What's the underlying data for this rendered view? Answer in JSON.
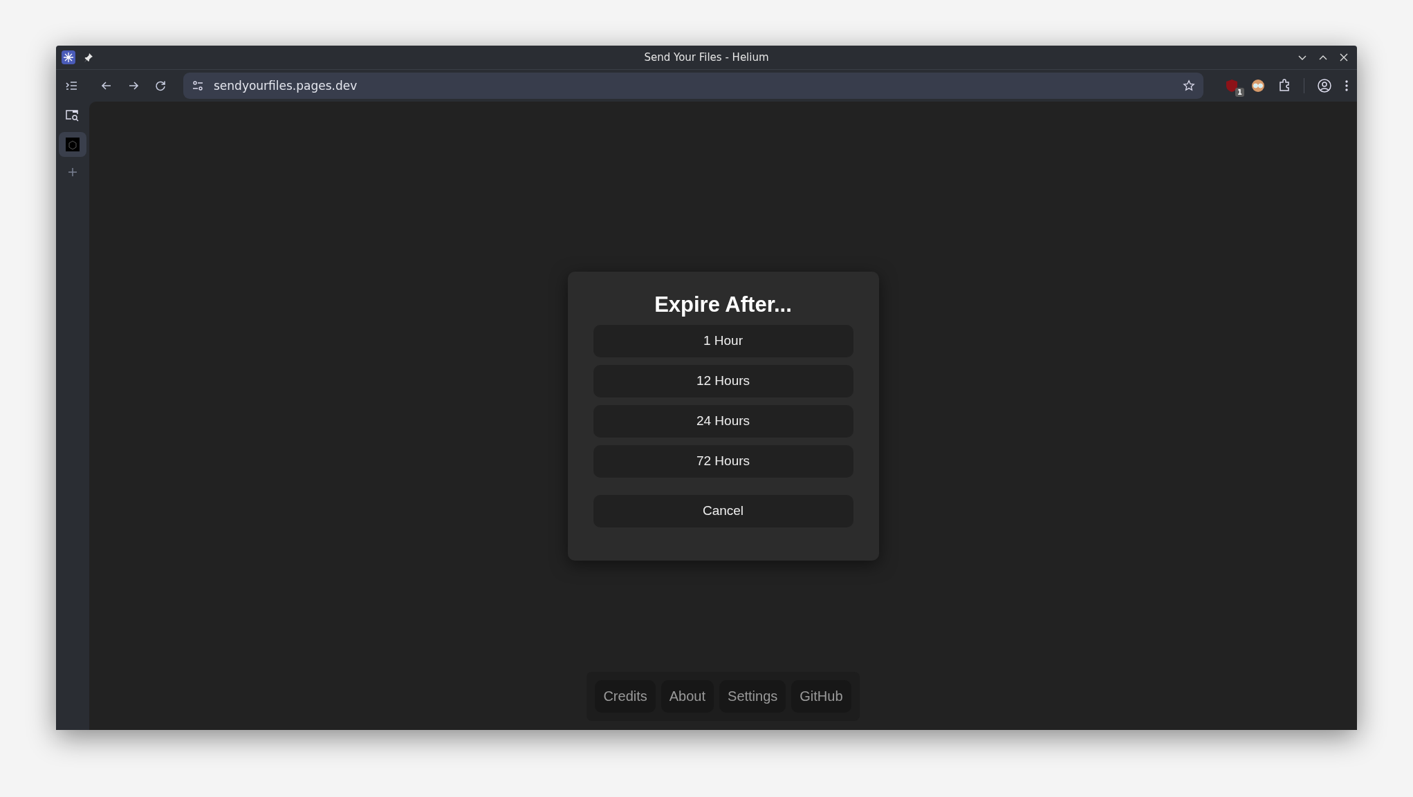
{
  "window": {
    "title": "Send Your Files - Helium"
  },
  "toolbar": {
    "address": "sendyourfiles.pages.dev",
    "extension_badge": "1"
  },
  "dialog": {
    "title": "Expire After...",
    "options": [
      "1 Hour",
      "12 Hours",
      "24 Hours",
      "72 Hours"
    ],
    "cancel": "Cancel"
  },
  "footer": {
    "links": [
      "Credits",
      "About",
      "Settings",
      "GitHub"
    ]
  }
}
